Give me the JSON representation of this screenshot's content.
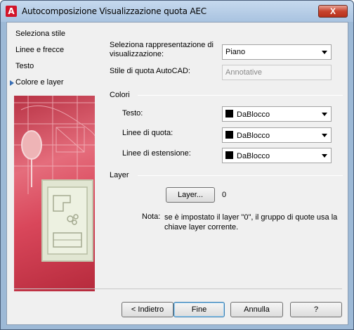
{
  "window": {
    "title": "Autocomposizione Visualizzazione quota AEC",
    "close_symbol": "X"
  },
  "steps": [
    {
      "label": "Seleziona stile",
      "active": false
    },
    {
      "label": "Linee e frecce",
      "active": false
    },
    {
      "label": "Testo",
      "active": false
    },
    {
      "label": "Colore e layer",
      "active": true
    }
  ],
  "display_rep": {
    "label": "Seleziona rappresentazione di visualizzazione:",
    "value": "Piano"
  },
  "autocad_style": {
    "label": "Stile di quota AutoCAD:",
    "value": "Annotative"
  },
  "colors": {
    "section_label": "Colori",
    "text": {
      "label": "Testo:",
      "value": "DaBlocco"
    },
    "dim_lines": {
      "label": "Linee di quota:",
      "value": "DaBlocco"
    },
    "ext_lines": {
      "label": "Linee di estensione:",
      "value": "DaBlocco"
    }
  },
  "layer": {
    "section_label": "Layer",
    "button_label": "Layer...",
    "value": "0",
    "note_prefix": "Nota:",
    "note_text": "se è impostato il layer \"0\", il gruppo di quote usa la chiave layer corrente."
  },
  "footer": {
    "back_label": "< Indietro",
    "finish_label": "Fine",
    "cancel_label": "Annulla",
    "help_label": "?"
  },
  "icons": {
    "app": "autocad-a-icon",
    "active_step": "triangle-right-icon",
    "dropdown": "chevron-down-icon"
  },
  "colors_meta": {
    "accent": "#3a6fb5",
    "art_red": "#d9475b"
  }
}
